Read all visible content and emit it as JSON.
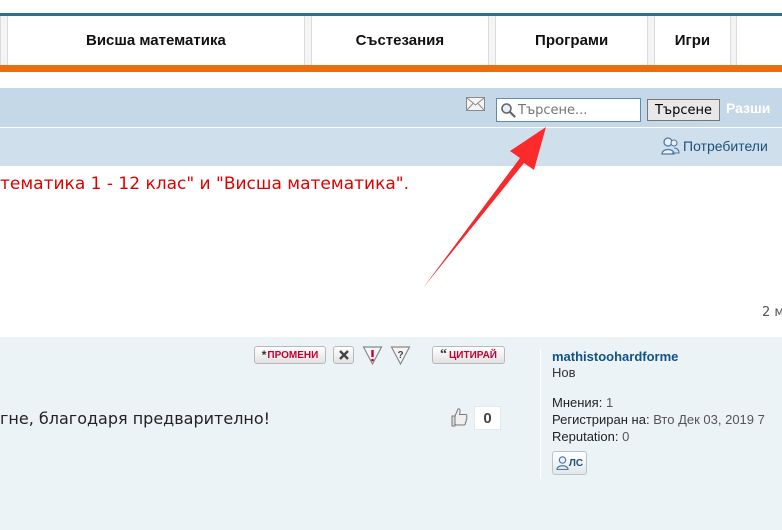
{
  "nav": {
    "items": [
      {
        "label": "Висша математика"
      },
      {
        "label": "Състезания"
      },
      {
        "label": "Програми"
      },
      {
        "label": "Игри"
      }
    ]
  },
  "search": {
    "placeholder": "Търсене...",
    "button_label": "Търсене",
    "advanced_label": "Разши"
  },
  "subbar": {
    "users_label": "Потребители"
  },
  "notice": {
    "text": "тематика 1 - 12 клас\" и \"Висша математика\"."
  },
  "pagination": {
    "text": "2 м"
  },
  "post": {
    "buttons": {
      "edit_label": "ПРОМЕНИ",
      "quote_label": "ЦИТИРАЙ"
    },
    "text": "гне, благодаря предварително!",
    "likes": "0",
    "author": {
      "name": "mathistoohardforme",
      "rank": "Нов",
      "posts_label": "Мнения:",
      "posts_value": "1",
      "registered_label": "Регистриран на:",
      "registered_value": "Вто Дек 03, 2019 7",
      "reputation_label": "Reputation:",
      "reputation_value": "0"
    },
    "pm_label": "ЛС"
  },
  "colors": {
    "accent_orange": "#e96f0d",
    "header_blue": "#c5d8e7",
    "notice_red": "#e00000",
    "arrow_red": "#e8141b"
  }
}
